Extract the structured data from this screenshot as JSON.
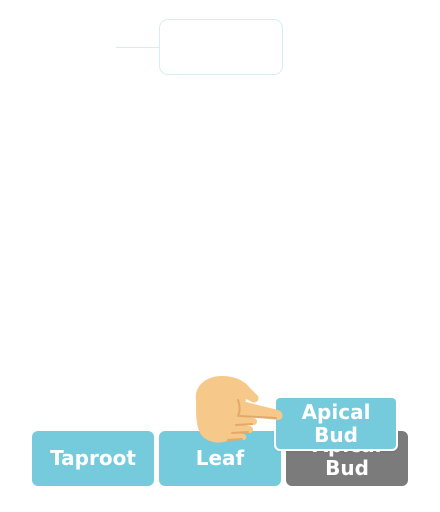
{
  "tiles": [
    {
      "label": "Taproot",
      "state": "default"
    },
    {
      "label": "Leaf",
      "state": "default"
    },
    {
      "label": "Apical Bud",
      "state": "placeholder"
    }
  ],
  "dragging_tile": {
    "label": "Apical Bud"
  },
  "colors": {
    "tile": "#75cbdc",
    "placeholder": "#7b7b7b",
    "drop_outline": "#d6eef2",
    "hand": "#f6c889",
    "hand_shadow": "#e6a869"
  },
  "icons": {
    "cursor": "pointing-hand-icon"
  }
}
